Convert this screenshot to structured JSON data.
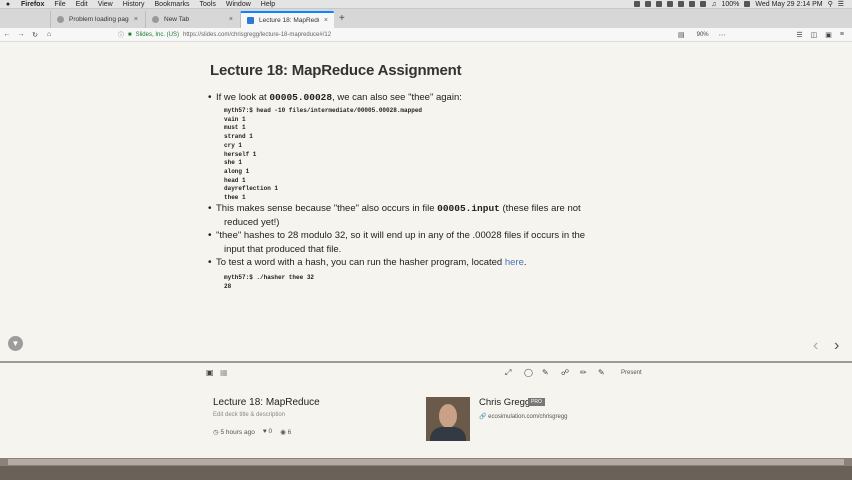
{
  "menubar": {
    "items": [
      "Firefox",
      "File",
      "Edit",
      "View",
      "History",
      "Bookmarks",
      "Tools",
      "Window",
      "Help"
    ],
    "battery": "100%",
    "clock": "Wed May 29 2:14 PM"
  },
  "tabs": [
    {
      "title": "Problem loading page",
      "active": false
    },
    {
      "title": "New Tab",
      "active": false
    },
    {
      "title": "Lecture 18: MapReduce",
      "active": true
    }
  ],
  "newtab_symbol": "+",
  "url": {
    "site_identity": "Slides, Inc. (US)",
    "address": "https://slides.com/chrisgregg/lecture-18-mapreduce#/12",
    "zoom": "90%"
  },
  "slide": {
    "title": "Lecture 18: MapReduce Assignment",
    "bullet1_pre": "If we look at ",
    "bullet1_code": "00005.00028",
    "bullet1_post": ", we can also see \"thee\" again:",
    "code_block": "myth57:$ head -10 files/intermediate/00005.00028.mapped\nvain 1\nmust 1\nstrand 1\ncry 1\nherself 1\nshe 1\nalong 1\nhead 1\ndayreflection 1\nthee 1",
    "bullet2_pre": "This makes sense because \"thee\" also occurs in file ",
    "bullet2_code": "00005.input",
    "bullet2_post": " (these files are not",
    "bullet2_cont": "reduced yet!)",
    "bullet3_line1": "\"thee\" hashes to 28 modulo 32, so it will end up in any of the .00028 files if occurs in the",
    "bullet3_line2": "input that produced that file.",
    "bullet4_pre": "To test a word with a hash, you can run the hasher program, located ",
    "bullet4_link": "here",
    "bullet4_post": ".",
    "code2": "myth57:$ ./hasher thee 32\n28"
  },
  "toolbar": {
    "present_label": "Present"
  },
  "deck": {
    "title": "Lecture 18: MapReduce",
    "edit_label": "Edit deck title & description",
    "time": "5 hours ago",
    "likes": "0",
    "views": "6"
  },
  "author": {
    "name": "Chris Gregg",
    "badge": "PRO",
    "site": "ecosimulation.com/chrisgregg"
  }
}
